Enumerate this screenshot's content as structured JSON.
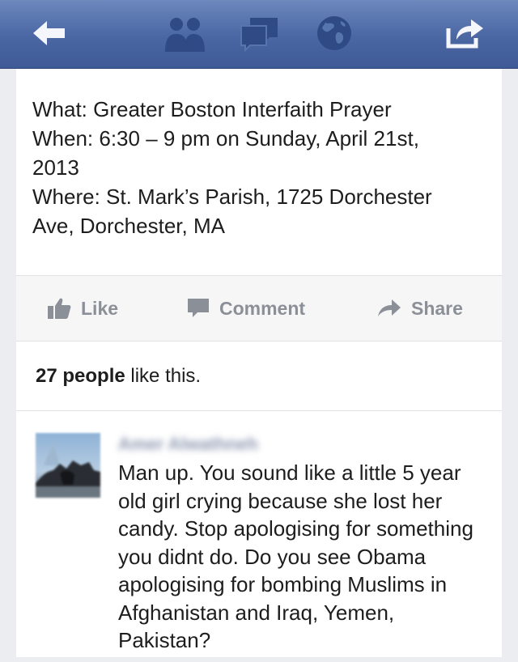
{
  "topbar": {
    "buttons": [
      {
        "name": "back-button",
        "icon": "back-arrow-icon"
      },
      {
        "name": "friend-requests-button",
        "icon": "friends-icon"
      },
      {
        "name": "messages-button",
        "icon": "messages-icon"
      },
      {
        "name": "notifications-button",
        "icon": "globe-icon"
      },
      {
        "name": "share-button",
        "icon": "share-icon"
      }
    ],
    "colors": {
      "bar_top": "#6d88bd",
      "bar_bottom": "#3f5a96",
      "icon": "#2f4a84"
    }
  },
  "post": {
    "what": "What: Greater Boston Interfaith Prayer",
    "when_line1": "When: 6:30 – 9 pm on Sunday, April 21st,",
    "when_line2": "2013",
    "where_line1": "Where: St. Mark’s Parish, 1725 Dorchester",
    "where_line2": "Ave, Dorchester, MA"
  },
  "actions": {
    "like_label": "Like",
    "comment_label": "Comment",
    "share_label": "Share"
  },
  "likes": {
    "count_text": "27 people",
    "suffix_text": " like this."
  },
  "comment": {
    "author": "Amer Alwathneh",
    "text": "Man up. You sound like a little 5 year old girl crying because she lost her candy. Stop apologising for something you didnt do. Do you see Obama apologising for bombing Muslims in Afghanistan and Iraq, Yemen, Pakistan?"
  }
}
